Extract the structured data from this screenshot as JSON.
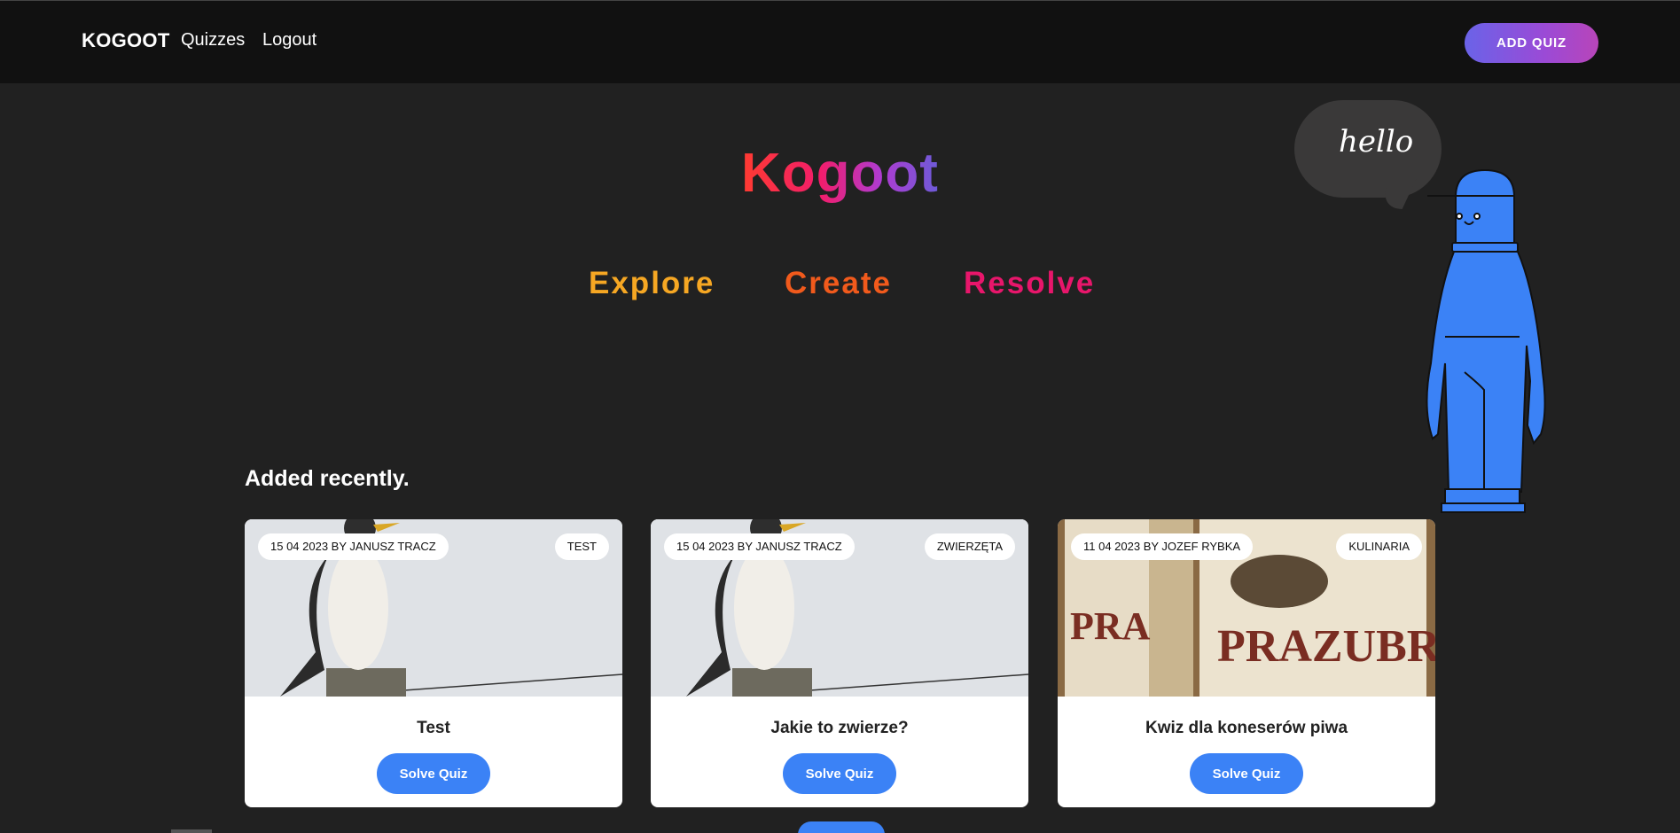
{
  "navbar": {
    "brand": "KOGOOT",
    "links": [
      "Quizzes",
      "Logout"
    ],
    "add_quiz_label": "ADD QUIZ"
  },
  "hero": {
    "title": "Kogoot",
    "taglines": [
      "Explore",
      "Create",
      "Resolve"
    ],
    "speech_bubble": "hello"
  },
  "recent": {
    "heading": "Added recently.",
    "cards": [
      {
        "date_author": "15 04 2023 BY JANUSZ TRACZ",
        "category": "TEST",
        "title": "Test",
        "button": "Solve Quiz",
        "image": "bird-photo"
      },
      {
        "date_author": "15 04 2023 BY JANUSZ TRACZ",
        "category": "ZWIERZĘTA",
        "title": "Jakie to zwierze?",
        "button": "Solve Quiz",
        "image": "bird-photo"
      },
      {
        "date_author": "11 04 2023 BY JOZEF RYBKA",
        "category": "KULINARIA",
        "title": "Kwiz dla koneserów piwa",
        "button": "Solve Quiz",
        "image": "beer-bottles-photo"
      }
    ]
  },
  "colors": {
    "background": "#212121",
    "navbar": "#111111",
    "accent_blue": "#3b82f6",
    "explore": "#f6a723",
    "create": "#f15a1c",
    "resolve": "#e8166b"
  }
}
